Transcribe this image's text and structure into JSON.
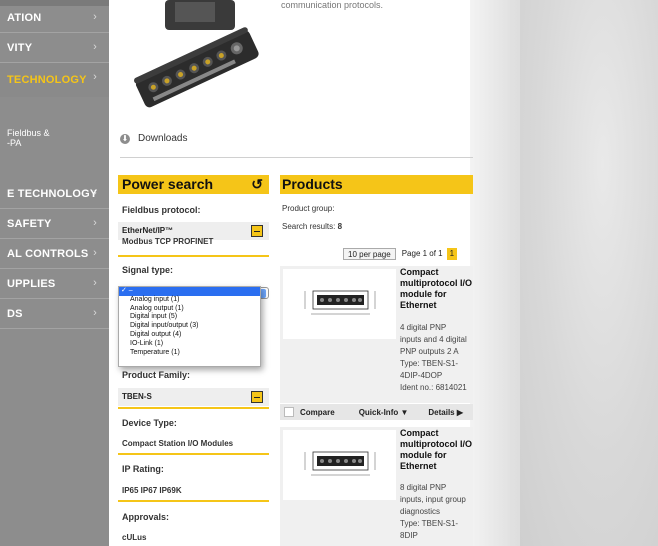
{
  "sidebar": {
    "items": [
      {
        "label": "ATION"
      },
      {
        "label": "VITY"
      },
      {
        "label": "TECHNOLOGY"
      },
      {
        "label": "E TECHNOLOGY"
      },
      {
        "label": "SAFETY"
      },
      {
        "label": "AL CONTROLS"
      },
      {
        "label": "UPPLIES"
      },
      {
        "label": "DS"
      }
    ],
    "sub_items": [
      "Fieldbus &",
      "-PA"
    ],
    "chevron": "›"
  },
  "product": {
    "top_text": "communication protocols.",
    "downloads_label": "Downloads"
  },
  "power_search": {
    "title": "Power search",
    "reset_icon": "↺",
    "fieldbus_label": "Fieldbus protocol:",
    "fieldbus_selected": "EtherNet/IP™",
    "fieldbus_other": "Modbus TCP PROFINET",
    "signal_label": "Signal type:",
    "signal_options": [
      "✓ –",
      "Analog input (1)",
      "Analog output (1)",
      "Digital input (5)",
      "Digital input/output (3)",
      "Digital output (4)",
      "IO-Link (1)",
      "Temperature (1)"
    ],
    "family_label": "Product Family:",
    "family_selected": "TBEN-S",
    "device_label": "Device Type:",
    "device_value": "Compact Station I/O Modules",
    "ip_label": "IP Rating:",
    "ip_value": "IP65 IP67 IP69K",
    "approvals_label": "Approvals:",
    "approvals_value": "cULus"
  },
  "products": {
    "title": "Products",
    "group_label": "Product group:",
    "results_label": "Search results:",
    "results_count": "8",
    "per_page": "10 per page",
    "page_info": "Page 1 of 1",
    "page_num": "1",
    "cards": [
      {
        "title": "Compact multiprotocol I/O module for Ethernet",
        "desc_lines": [
          "4 digital PNP",
          "inputs and 4 digital",
          "PNP outputs 2 A",
          "Type: TBEN-S1-",
          "4DIP-4DOP",
          "Ident no.: 6814021"
        ]
      },
      {
        "title": "Compact multiprotocol I/O module for Ethernet",
        "desc_lines": [
          "8 digital PNP",
          "inputs, input group",
          "diagnostics",
          "Type: TBEN-S1-",
          "8DIP"
        ]
      }
    ],
    "compare_label": "Compare",
    "quickinfo_label": "Quick-Info ▼",
    "details_label": "Details ▶"
  },
  "colors": {
    "accent": "#f5c518",
    "sidebar": "#8d8d8d",
    "select_highlight": "#2a6ef0"
  }
}
